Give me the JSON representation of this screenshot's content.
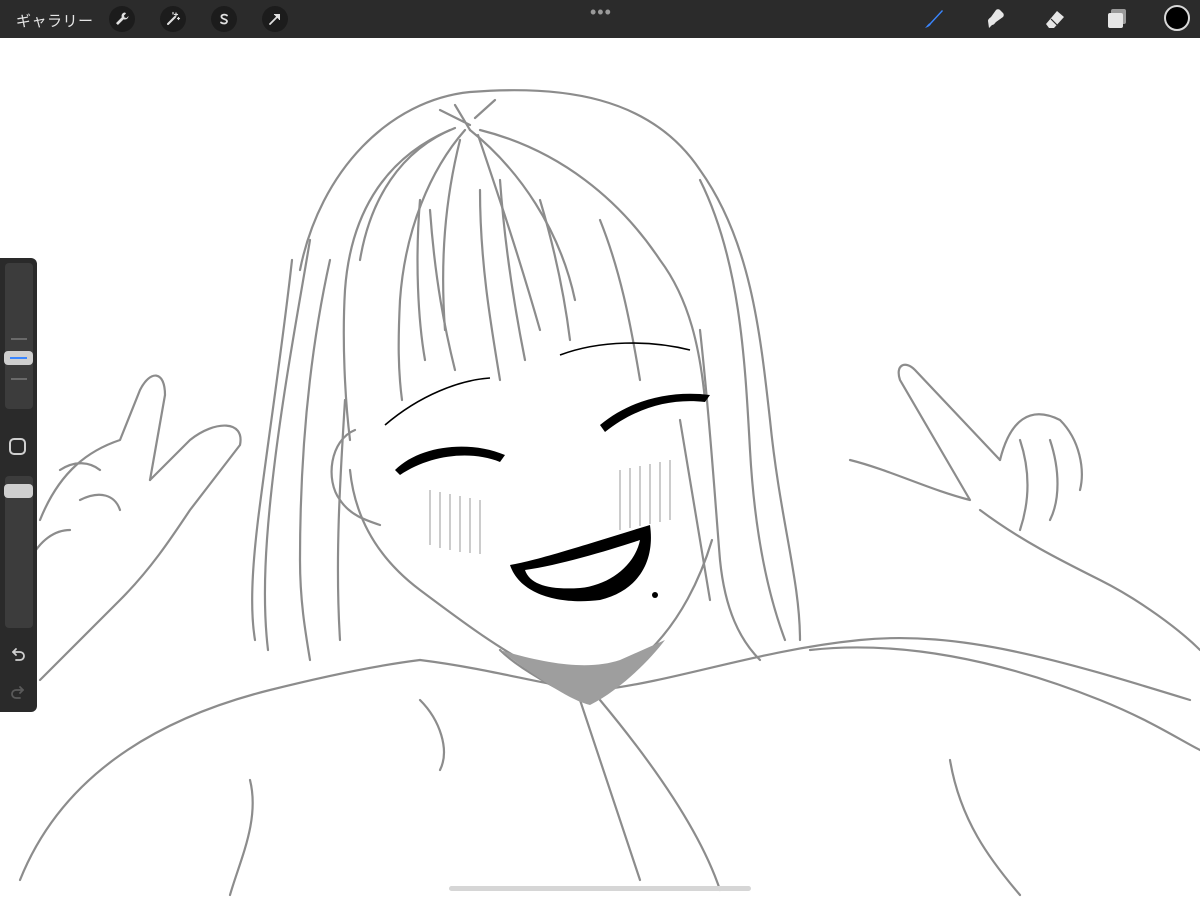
{
  "topbar": {
    "gallery_label": "ギャラリー",
    "left_tools": [
      {
        "name": "actions",
        "icon": "wrench-icon"
      },
      {
        "name": "adjustments",
        "icon": "magic-wand-icon"
      },
      {
        "name": "selection",
        "icon": "selection-s-icon"
      },
      {
        "name": "transform",
        "icon": "arrow-cursor-icon"
      }
    ],
    "right_tools": [
      {
        "name": "brush",
        "icon": "brush-icon",
        "active": true
      },
      {
        "name": "smudge",
        "icon": "smudge-icon",
        "active": false
      },
      {
        "name": "eraser",
        "icon": "eraser-icon",
        "active": false
      },
      {
        "name": "layers",
        "icon": "layers-icon",
        "active": false
      }
    ],
    "current_color": "#000000",
    "accent_color": "#3a86ff"
  },
  "sidebar": {
    "brush_size_level": 0.35,
    "opacity_level": 0.95,
    "undo_icon": "undo-icon",
    "redo_icon": "redo-icon",
    "modify_icon": "square-modify-icon"
  },
  "canvas": {
    "content": "sketch"
  }
}
